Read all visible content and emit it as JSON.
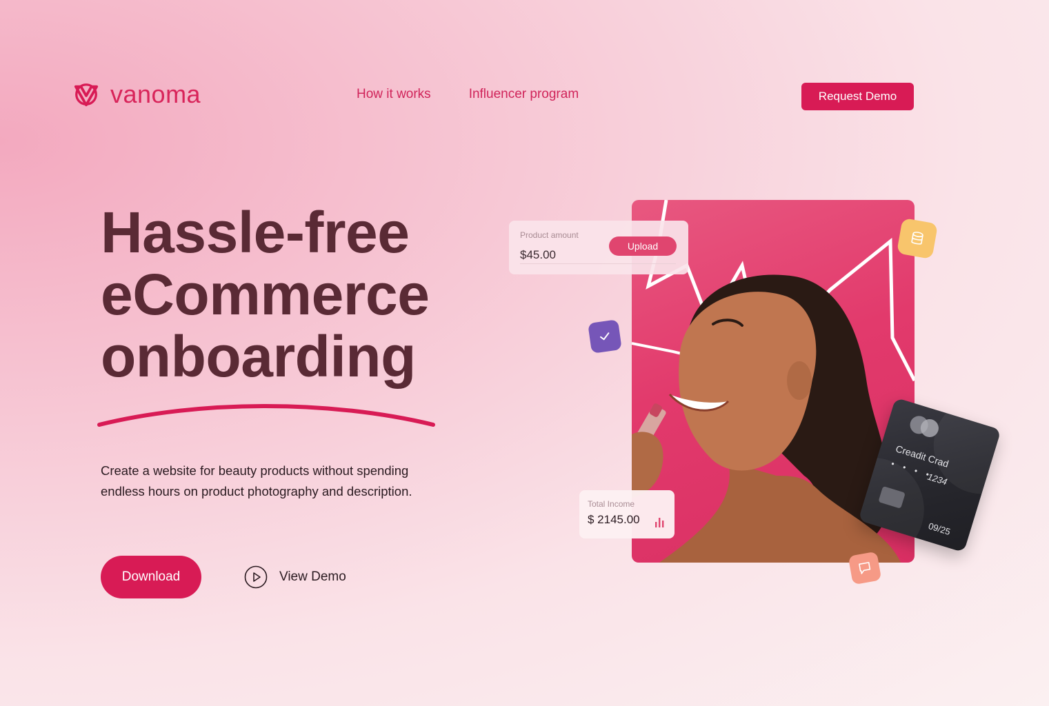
{
  "brand": {
    "name": "vanoma",
    "accent_color": "#d81b55",
    "icon": "vanoma-logo-icon"
  },
  "nav": {
    "items": [
      {
        "label": "How it works"
      },
      {
        "label": "Influencer program"
      }
    ]
  },
  "header": {
    "cta_label": "Request Demo"
  },
  "hero": {
    "headline_lines": [
      "Hassle-free",
      "eCommerce",
      "onboarding"
    ],
    "description": "Create a website for beauty products without spending endless hours on product photography and description.",
    "primary_cta": "Download",
    "secondary_cta": "View Demo",
    "secondary_icon": "play-circle-icon"
  },
  "visual": {
    "product_card": {
      "label": "Product amount",
      "value": "$45.00",
      "button": "Upload"
    },
    "income_card": {
      "label": "Total Income",
      "value": "$ 2145.00",
      "icon": "bar-chart-icon"
    },
    "credit_card": {
      "title": "Creadit Crad",
      "masked": "• • • •",
      "last4": "1234",
      "expiry": "09/25"
    },
    "badges": [
      "check-icon",
      "coins-icon",
      "chat-icon"
    ]
  }
}
